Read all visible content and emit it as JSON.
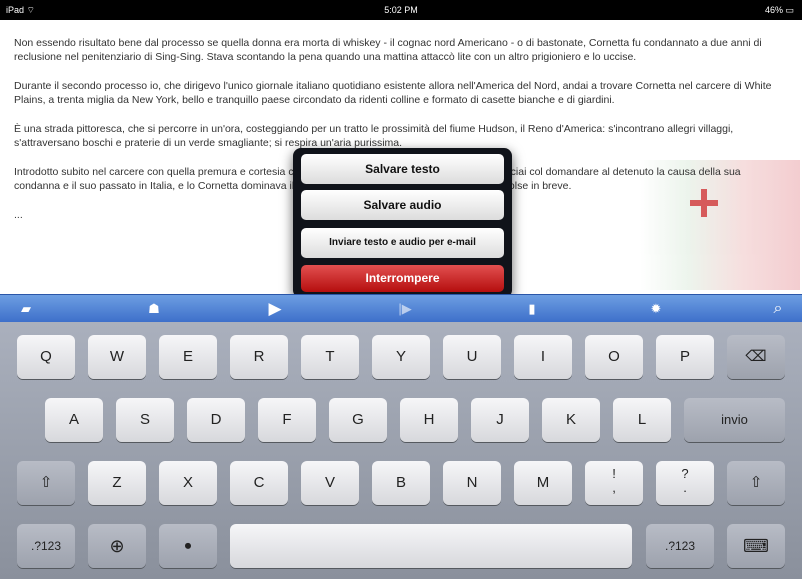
{
  "status": {
    "carrier": "iPad ⌔",
    "time": "5:02 PM",
    "battery": "46% ▭"
  },
  "text": {
    "p1": "Non essendo risultato bene dal processo se quella donna era morta di whiskey - il cognac nord Americano - o di bastonate, Cornetta fu condannato a due anni di reclusione nel penitenziario di Sing-Sing. Stava scontando la pena quando una mattina attaccò lite con un altro prigioniero e lo uccise.",
    "p2": "Durante il secondo processo io, che dirigevo l'unico giornale italiano quotidiano esistente allora nell'America del Nord, andai a trovare Cornetta nel carcere di White Plains, a trenta miglia da New York, bello e tranquillo paese circondato da ridenti colline e formato di casette bianche e di giardini.",
    "p3": "È una strada pittoresca, che si percorre in un'ora, costeggiando per un tratto le prossimità del fiume Hudson, il Reno d'America: s'incontrano allegri villaggi, s'attraversano boschi e praterie di un verde smagliante; si respira un'aria purissima.",
    "p4": "Introdotto subito nel carcere con quella premura e cortesia con cui in America si ricevono i reporters, cominciai col domandare al detenuto la causa della sua condanna e il suo passato in Italia, e lo Cornetta dominava il suo passato, in America e in Italia, come si svolse in breve.",
    "ellipsis": "..."
  },
  "popover": {
    "save_text": "Salvare testo",
    "save_audio": "Salvare audio",
    "send_email": "Inviare testo e audio per e-mail",
    "stop": "Interrompere"
  },
  "toolbar": {
    "icons": [
      "open-file-icon",
      "share-icon",
      "play-icon",
      "step-icon",
      "clipboard-icon",
      "gear-icon",
      "search-icon"
    ],
    "glyphs": [
      "▰",
      "☗",
      "▶",
      "|▶",
      "▮",
      "✹",
      "⌕"
    ]
  },
  "keyboard": {
    "row1": [
      "Q",
      "W",
      "E",
      "R",
      "T",
      "Y",
      "U",
      "I",
      "O",
      "P"
    ],
    "backspace": "⌫",
    "row2": [
      "A",
      "S",
      "D",
      "F",
      "G",
      "H",
      "J",
      "K",
      "L"
    ],
    "return": "invio",
    "shift": "⇧",
    "row3": [
      "Z",
      "X",
      "C",
      "V",
      "B",
      "N",
      "M"
    ],
    "excl": "!",
    "excl_sub": ",",
    "quest": "?",
    "quest_sub": ".",
    "numbers": ".?123",
    "globe": "⊕",
    "mic": "⏺",
    "hide": "⌨"
  }
}
